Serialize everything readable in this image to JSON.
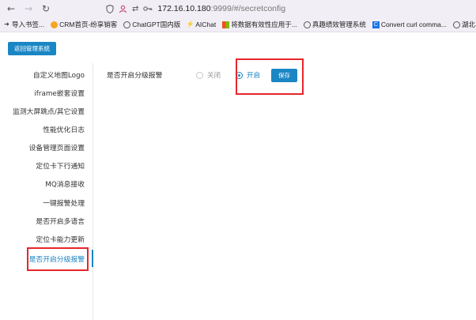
{
  "browser": {
    "url_host": "172.16.10.180",
    "url_rest": ":9999/#/secretconfig",
    "bookmarks": [
      {
        "label": "导入书签...",
        "icon": "import-icon"
      },
      {
        "label": "CRM首页-纷享销客",
        "icon": "crm-icon"
      },
      {
        "label": "ChatGPT国内版",
        "icon": "globe-icon"
      },
      {
        "label": "AIChat",
        "icon": "aichat-icon"
      },
      {
        "label": "将数据有效性应用于...",
        "icon": "windows-icon"
      },
      {
        "label": "真趣绩效管理系统",
        "icon": "globe-icon"
      },
      {
        "label": "Convert curl comma...",
        "icon": "convert-icon"
      },
      {
        "label": "湖北孚诺林人员定位...",
        "icon": "globe-icon"
      }
    ]
  },
  "header": {
    "back_label": "返回管理系统"
  },
  "sidebar": {
    "items": [
      {
        "label": "自定义地图Logo"
      },
      {
        "label": "iframe嵌套设置"
      },
      {
        "label": "监测大屏跳点/其它设置"
      },
      {
        "label": "性能优化日志"
      },
      {
        "label": "设备管理页面设置"
      },
      {
        "label": "定位卡下行通知"
      },
      {
        "label": "MQ消息接收"
      },
      {
        "label": "一键报警处理"
      },
      {
        "label": "是否开启多语言"
      },
      {
        "label": "定位卡能力更新"
      },
      {
        "label": "是否开启分级报警"
      }
    ],
    "active_index": 10
  },
  "form": {
    "label": "是否开启分级报警",
    "options": [
      {
        "label": "关闭",
        "checked": false
      },
      {
        "label": "开启",
        "checked": true
      }
    ],
    "save_label": "保存"
  },
  "colors": {
    "accent": "#1a86c4",
    "highlight": "#e8252a"
  }
}
